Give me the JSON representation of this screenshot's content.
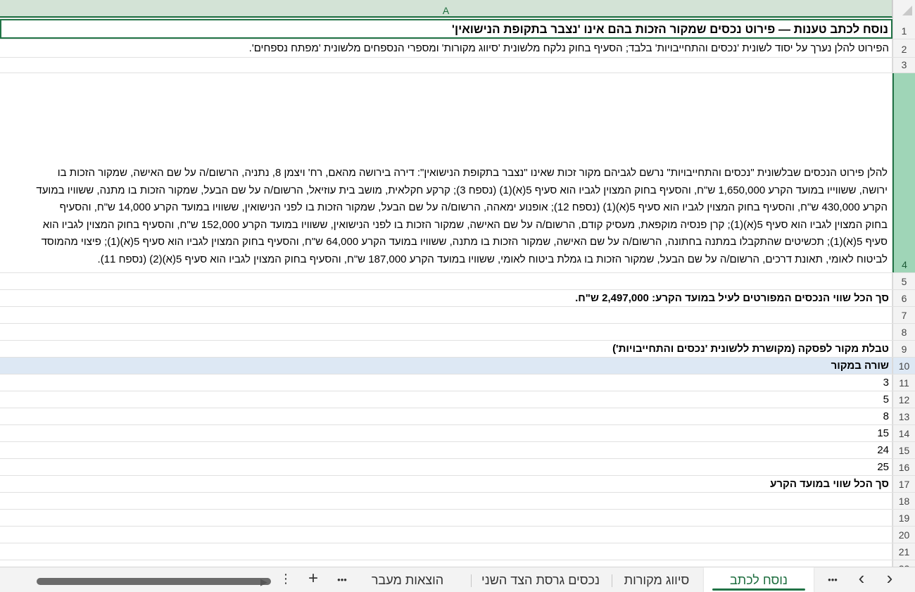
{
  "columns": {
    "a": "A"
  },
  "rows": [
    {
      "num": "1",
      "text": "נוסח לכתב טענות — פירוט נכסים שמקור הזכות בהם אינו 'נצבר בתקופת הנישואין'"
    },
    {
      "num": "2",
      "text": "הפירוט להלן נערך על יסוד לשונית 'נכסים והתחייבויות' בלבד; הסעיף בחוק נלקח מלשונית 'סיווג מקורות' ומספרי הנספחים מלשונית 'מפתח נספחים'."
    },
    {
      "num": "3",
      "text": ""
    },
    {
      "num": "4",
      "lines": [
        "להלן פירוט הנכסים שבלשונית \"נכסים והתחייבויות\" נרשם לגביהם מקור זכות שאינו \"נצבר בתקופת הנישואין\": דירה בירושה מהאם, רח' ויצמן 8, נתניה, הרשום/ה על שם האישה, שמקור הזכות בו",
        "ירושה, ששווייו במועד הקרע 1,650,000 ש\"ח, והסעיף בחוק המצוין לגביו הוא סעיף 5(א)(1) (נספח 3); קרקע חקלאית, מושב בית עוזיאל, הרשום/ה על שם הבעל, שמקור הזכות בו מתנה, ששוויו במועד",
        "הקרע 430,000 ש\"ח, והסעיף בחוק המצוין לגביו הוא סעיף 5(א)(1) (נספח 12); אופנוע ימאהה, הרשום/ה על שם הבעל, שמקור הזכות בו לפני הנישואין, ששוויו במועד הקרע 14,000 ש\"ח, והסעיף",
        "בחוק המצוין לגביו הוא סעיף 5(א)(1); קרן פנסיה מוקפאת, מעסיק קודם, הרשום/ה על שם האישה, שמקור הזכות בו לפני הנישואין, ששוויו במועד הקרע 152,000 ש\"ח, והסעיף בחוק המצוין לגביו הוא",
        "סעיף 5(א)(1); תכשיטים שהתקבלו במתנה בחתונה, הרשום/ה על שם האישה, שמקור הזכות בו מתנה, ששוויו במועד הקרע 64,000 ש\"ח, והסעיף בחוק המצוין לגביו הוא סעיף 5(א)(1); פיצוי מהמוסד",
        "לביטוח לאומי, תאונת דרכים, הרשום/ה על שם הבעל, שמקור הזכות בו גמלת ביטוח לאומי, ששוויו במועד הקרע 187,000 ש\"ח, והסעיף בחוק המצוין לגביו הוא סעיף 5(א)(2) (נספח 11)."
      ]
    },
    {
      "num": "5",
      "text": ""
    },
    {
      "num": "6",
      "text": "סך הכל שווי הנכסים המפורטים לעיל במועד הקרע: 2,497,000 ש\"ח."
    },
    {
      "num": "7",
      "text": ""
    },
    {
      "num": "8",
      "text": ""
    },
    {
      "num": "9",
      "text": "טבלת מקור לפסקה (מקושרת ללשונית 'נכסים והתחייבויות')"
    },
    {
      "num": "10",
      "text": "שורה במקור"
    },
    {
      "num": "11",
      "text": "3"
    },
    {
      "num": "12",
      "text": "5"
    },
    {
      "num": "13",
      "text": "8"
    },
    {
      "num": "14",
      "text": "15"
    },
    {
      "num": "15",
      "text": "24"
    },
    {
      "num": "16",
      "text": "25"
    },
    {
      "num": "17",
      "text": "סך הכל שווי במועד הקרע"
    },
    {
      "num": "18",
      "text": ""
    },
    {
      "num": "19",
      "text": ""
    },
    {
      "num": "20",
      "text": ""
    },
    {
      "num": "21",
      "text": ""
    },
    {
      "num": "22",
      "text": ""
    }
  ],
  "tabs": {
    "active": "נוסח לכתב טענות",
    "tab2": "סיווג מקורות",
    "tab3": "נכסים גרסת הצד השני",
    "tab4": "הוצאות מעבר למזונ",
    "more": "•••",
    "add": "+",
    "menu": "⋮",
    "prev": "‹",
    "next": "›"
  },
  "colors": {
    "accent": "#217346",
    "selected_row_header": "#9fd5b7",
    "highlight_row": "#dde8f4"
  }
}
